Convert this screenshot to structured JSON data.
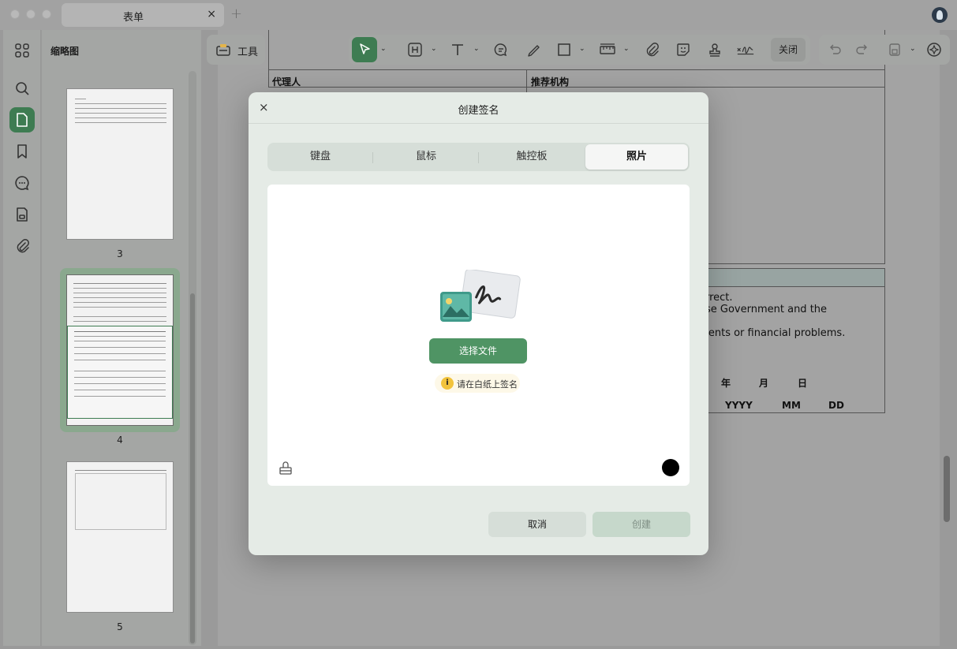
{
  "window": {
    "tab_title": "表单",
    "tab_close": "×",
    "tab_add": "+"
  },
  "rail": {
    "items": [
      "thumbnails-icon",
      "search-icon",
      "page-icon",
      "bookmark-icon",
      "comment-icon",
      "form-icon",
      "attachment-icon"
    ],
    "active": "page-icon"
  },
  "thumbs_panel": {
    "title": "缩略图",
    "pages": [
      "3",
      "4",
      "5"
    ],
    "selected_page": "4"
  },
  "toolbar": {
    "tools_label": "工具",
    "close_label": "关闭"
  },
  "document": {
    "table_header_left": "代理人",
    "table_header_right": "推荐机构",
    "line1": "orrect.",
    "line2": "ese Government and the",
    "line3": "idents or financial problems.",
    "date_year": "年",
    "date_month": "月",
    "date_day": "日",
    "date_year_fmt": "YYYY",
    "date_month_fmt": "MM",
    "date_day_fmt": "DD"
  },
  "modal": {
    "title": "创建签名",
    "close": "×",
    "tabs": [
      {
        "label": "键盘"
      },
      {
        "label": "鼠标"
      },
      {
        "label": "触控板"
      },
      {
        "label": "照片"
      }
    ],
    "active_tab": "照片",
    "choose_file_label": "选择文件",
    "hint_icon": "i",
    "hint_text": "请在白纸上签名",
    "pen_color": "#000000",
    "cancel_label": "取消",
    "create_label": "创建"
  },
  "colors": {
    "accent": "#3e7c52",
    "button_primary": "#4f9464",
    "hint_badge": "#f2c33c"
  }
}
